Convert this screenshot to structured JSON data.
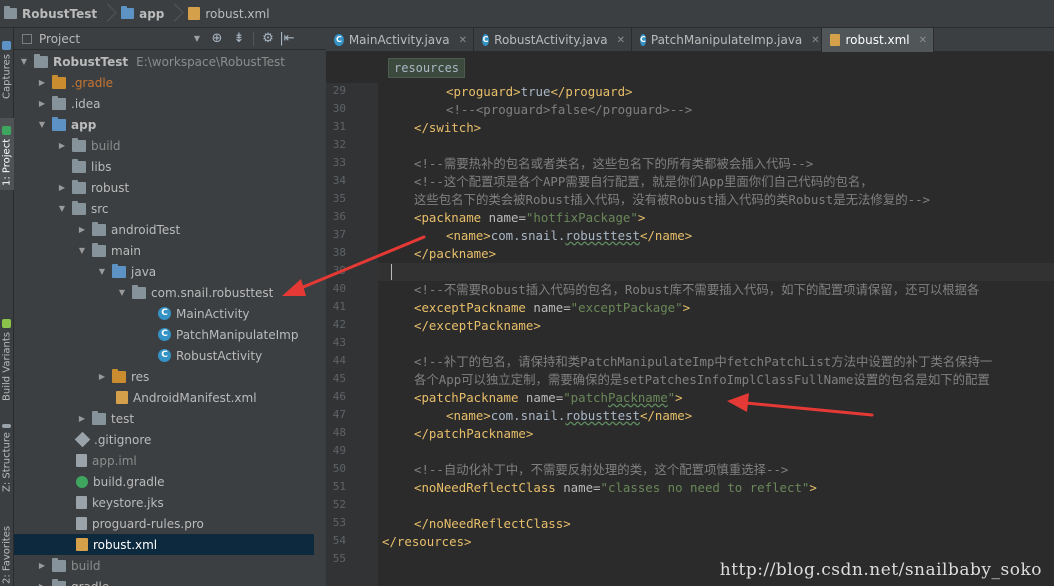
{
  "breadcrumb": {
    "items": [
      {
        "label": "RobustTest"
      },
      {
        "label": "app"
      },
      {
        "label": "robust.xml"
      }
    ]
  },
  "left_strip": {
    "tabs": [
      {
        "label": "Captures"
      },
      {
        "label": "1: Project"
      },
      {
        "label": "Build Variants"
      },
      {
        "label": "Z: Structure"
      },
      {
        "label": "2: Favorites"
      }
    ]
  },
  "project_panel": {
    "view_selector": "Project",
    "tree": [
      {
        "label": "RobustTest",
        "path": "E:\\workspace\\RobustTest",
        "expanded": true
      },
      {
        "label": ".gradle",
        "expanded": false
      },
      {
        "label": ".idea",
        "expanded": false
      },
      {
        "label": "app",
        "expanded": true
      },
      {
        "label": "build",
        "expanded": false
      },
      {
        "label": "libs"
      },
      {
        "label": "robust",
        "expanded": false
      },
      {
        "label": "src",
        "expanded": true
      },
      {
        "label": "androidTest",
        "expanded": false
      },
      {
        "label": "main",
        "expanded": true
      },
      {
        "label": "java",
        "expanded": true
      },
      {
        "label": "com.snail.robusttest",
        "expanded": true
      },
      {
        "label": "MainActivity"
      },
      {
        "label": "PatchManipulateImp"
      },
      {
        "label": "RobustActivity"
      },
      {
        "label": "res",
        "expanded": false
      },
      {
        "label": "AndroidManifest.xml"
      },
      {
        "label": "test",
        "expanded": false
      },
      {
        "label": ".gitignore"
      },
      {
        "label": "app.iml"
      },
      {
        "label": "build.gradle"
      },
      {
        "label": "keystore.jks"
      },
      {
        "label": "proguard-rules.pro"
      },
      {
        "label": "robust.xml",
        "selected": true
      },
      {
        "label": "build",
        "expanded": false
      },
      {
        "label": "gradle",
        "expanded": false
      }
    ]
  },
  "editor": {
    "tabs": [
      {
        "label": "MainActivity.java",
        "active": false
      },
      {
        "label": "RobustActivity.java",
        "active": false
      },
      {
        "label": "PatchManipulateImp.java",
        "active": false
      },
      {
        "label": "robust.xml",
        "active": true
      }
    ],
    "xml_breadcrumb": "resources",
    "line_numbers": [
      "29",
      "30",
      "31",
      "32",
      "33",
      "34",
      "35",
      "36",
      "37",
      "38",
      "39",
      "40",
      "41",
      "42",
      "43",
      "44",
      "45",
      "46",
      "47",
      "48",
      "49",
      "50",
      "51",
      "52",
      "53",
      "54",
      "55"
    ],
    "lines": [
      "<proguard>true</proguard>",
      "<!--<proguard>false</proguard>-->",
      "</switch>",
      "",
      "<!--需要热补的包名或者类名，这些包名下的所有类都被会插入代码-->",
      "<!--这个配置项是各个APP需要自行配置，就是你们App里面你们自己代码的包名，",
      "这些包名下的类会被Robust插入代码，没有被Robust插入代码的类Robust是无法修复的-->",
      "<packname name=\"hotfixPackage\">",
      "<name>com.snail.robusttest</name>",
      "</packname>",
      "",
      "<!--不需要Robust插入代码的包名，Robust库不需要插入代码，如下的配置项请保留，还可以根据各",
      "<exceptPackname name=\"exceptPackage\">",
      "</exceptPackname>",
      "",
      "<!--补丁的包名，请保持和类PatchManipulateImp中fetchPatchList方法中设置的补丁类名保持一",
      "各个App可以独立定制，需要确保的是setPatchesInfoImplClassFullName设置的包名是如下的配置",
      "<patchPackname name=\"patchPackname\">",
      "<name>com.snail.robusttest</name>",
      "</patchPackname>",
      "",
      "<!--自动化补丁中，不需要反射处理的类，这个配置项慎重选择-->",
      "<noNeedReflectClass name=\"classes no need to reflect\">",
      "",
      "</noNeedReflectClass>",
      "</resources>",
      ""
    ]
  },
  "watermark": "http://blog.csdn.net/snailbaby_soko",
  "colors": {
    "arrow": "#e53935",
    "background": "#2b2b2b",
    "panel": "#3c3f41",
    "xml_tag": "#e8bf6a",
    "xml_value": "#6a8759",
    "comment": "#808080"
  }
}
